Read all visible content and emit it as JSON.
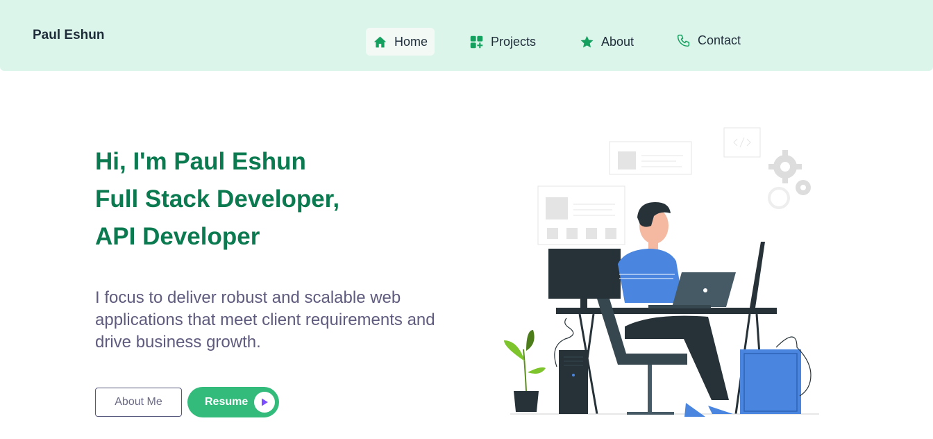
{
  "brand": {
    "name": "Paul Eshun"
  },
  "nav": {
    "items": [
      {
        "label": "Home",
        "icon": "home-icon",
        "active": true
      },
      {
        "label": "Projects",
        "icon": "apps-add-icon",
        "active": false
      },
      {
        "label": "About",
        "icon": "star-icon",
        "active": false
      },
      {
        "label": "Contact",
        "icon": "phone-icon",
        "active": false
      }
    ]
  },
  "hero": {
    "lines": [
      "Hi, I'm Paul Eshun",
      "Full Stack Developer,",
      "API Developer"
    ],
    "description": "I focus to deliver robust and scalable web applications that meet client requirements and drive business growth.",
    "about_button": "About Me",
    "resume_button": "Resume"
  },
  "colors": {
    "accent": "#0c7a50",
    "nav_bg": "#dcf5ea",
    "button_green": "#33bb7c",
    "icon_green": "#15a060",
    "play_purple": "#7b4dff"
  }
}
